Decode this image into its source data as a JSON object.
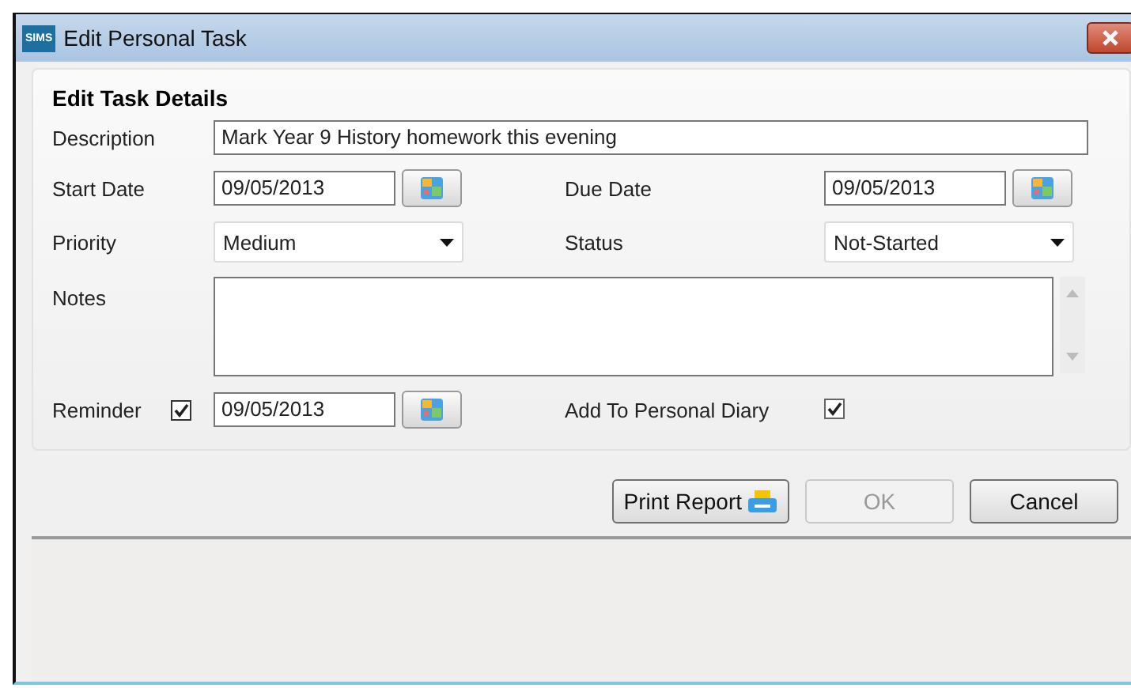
{
  "window": {
    "title": "Edit Personal Task",
    "app_badge": "SIMS"
  },
  "section_title": "Edit Task Details",
  "description": {
    "label": "Description",
    "value": "Mark Year 9 History homework this evening"
  },
  "start_date": {
    "label": "Start Date",
    "value": "09/05/2013"
  },
  "due_date": {
    "label": "Due Date",
    "value": "09/05/2013"
  },
  "priority": {
    "label": "Priority",
    "value": "Medium"
  },
  "status": {
    "label": "Status",
    "value": "Not-Started"
  },
  "notes": {
    "label": "Notes"
  },
  "reminder": {
    "label": "Reminder",
    "checked": true,
    "value": "09/05/2013"
  },
  "add_to_diary": {
    "label": "Add To Personal Diary",
    "checked": true
  },
  "buttons": [
    {
      "label": "Print Report",
      "kind": "print",
      "disabled": false
    },
    {
      "label": "OK",
      "kind": "plain",
      "disabled": true
    },
    {
      "label": "Cancel",
      "kind": "plain",
      "disabled": false
    }
  ]
}
